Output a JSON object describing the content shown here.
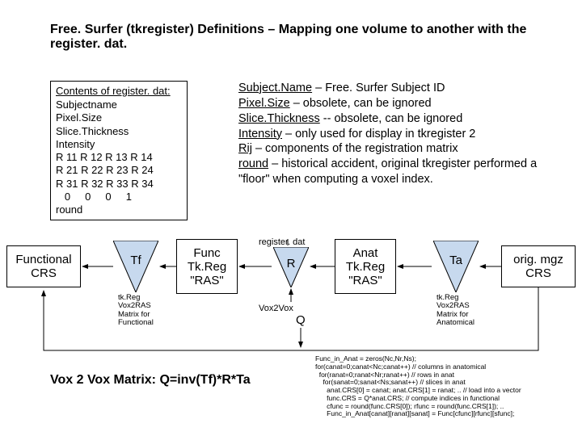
{
  "title": "Free. Surfer (tkregister) Definitions – Mapping one volume to another with the register. dat.",
  "contents": {
    "header": "Contents of register. dat:",
    "lines": [
      "Subjectname",
      "Pixel.Size",
      "Slice.Thickness",
      "Intensity",
      "R 11 R 12 R 13 R 14",
      "R 21 R 22 R 23 R 24",
      "R 31 R 32 R 33 R 34",
      "   0     0     0     1",
      "round"
    ]
  },
  "desc": {
    "l1u": "Subject.Name",
    "l1t": " – Free. Surfer Subject ID",
    "l2u": "Pixel.Size",
    "l2t": " – obsolete, can be ignored",
    "l3u": "Slice.Thickness",
    "l3t": " -- obsolete, can be ignored",
    "l4u": "Intensity",
    "l4t": " – only used for display in tkregister 2",
    "l5u": "Rij",
    "l5t": " – components of the registration matrix",
    "l6u": "round",
    "l6t": " – historical accident, original tkregister performed a \"floor\" when computing a voxel index."
  },
  "flow": {
    "func_crs": "Functional\nCRS",
    "tf": "Tf",
    "tf_sub": "tk.Reg\nVox2RAS\nMatrix for\nFunctional",
    "func_tkreg": "Func\nTk.Reg\n\"RAS\"",
    "r": "R",
    "r_above": "register. dat",
    "r_below": "Vox2Vox",
    "anat_tkreg": "Anat\nTk.Reg\n\"RAS\"",
    "ta": "Ta",
    "ta_sub": "tk.Reg\nVox2RAS\nMatrix for\nAnatomical",
    "orig_crs": "orig. mgz\nCRS",
    "q": "Q"
  },
  "formula": "Vox 2 Vox Matrix: Q=inv(Tf)*R*Ta",
  "code": "Func_in_Anat = zeros(Nc,Nr,Ns);\nfor(canat=0;canat<Nc;canat++) // columns in anatomical\n  for(ranat=0;ranat<Nr;ranat++) // rows in anat\n    for(sanat=0;sanat<Ns;sanat++) // slices in anat\n      anat.CRS[0] = canat; anat.CRS[1] = ranat; .. // load into a vector\n      func.CRS = Q*anat.CRS; // compute indices in functional\n      cfunc = round(func.CRS[0]); rfunc = round(func.CRS[1]); ..\n      Func_in_Anat[canat][ranat][sanat] = Func[cfunc][rfunc][sfunc];"
}
